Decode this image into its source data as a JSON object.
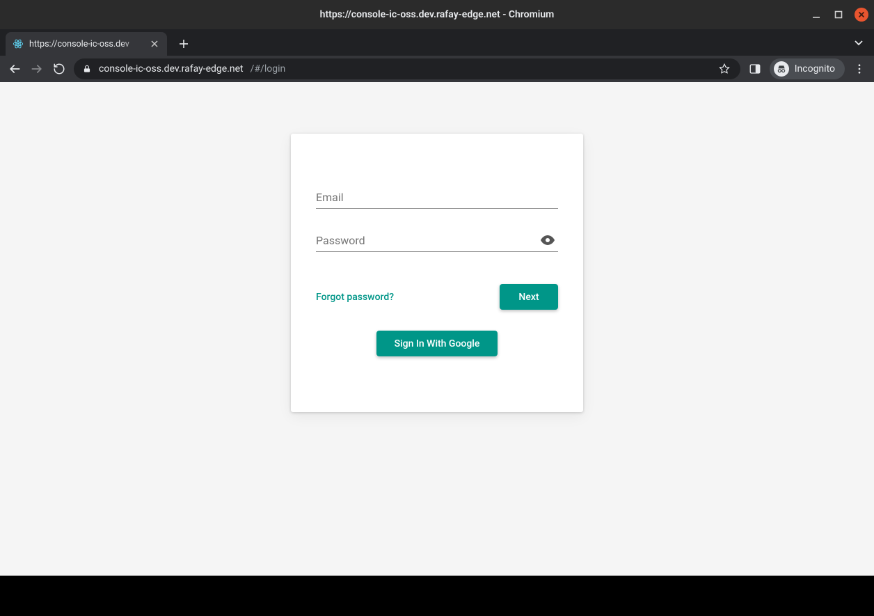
{
  "window": {
    "title": "https://console-ic-oss.dev.rafay-edge.net - Chromium"
  },
  "browser": {
    "tab_title": "https://console-ic-oss.dev",
    "url_host": "console-ic-oss.dev.rafay-edge.net",
    "url_path": "/#/login",
    "incognito_label": "Incognito"
  },
  "login": {
    "email_label": "Email",
    "email_value": "",
    "password_label": "Password",
    "password_value": "",
    "forgot_label": "Forgot password?",
    "next_label": "Next",
    "google_label": "Sign In With Google"
  },
  "colors": {
    "accent": "#009688"
  }
}
